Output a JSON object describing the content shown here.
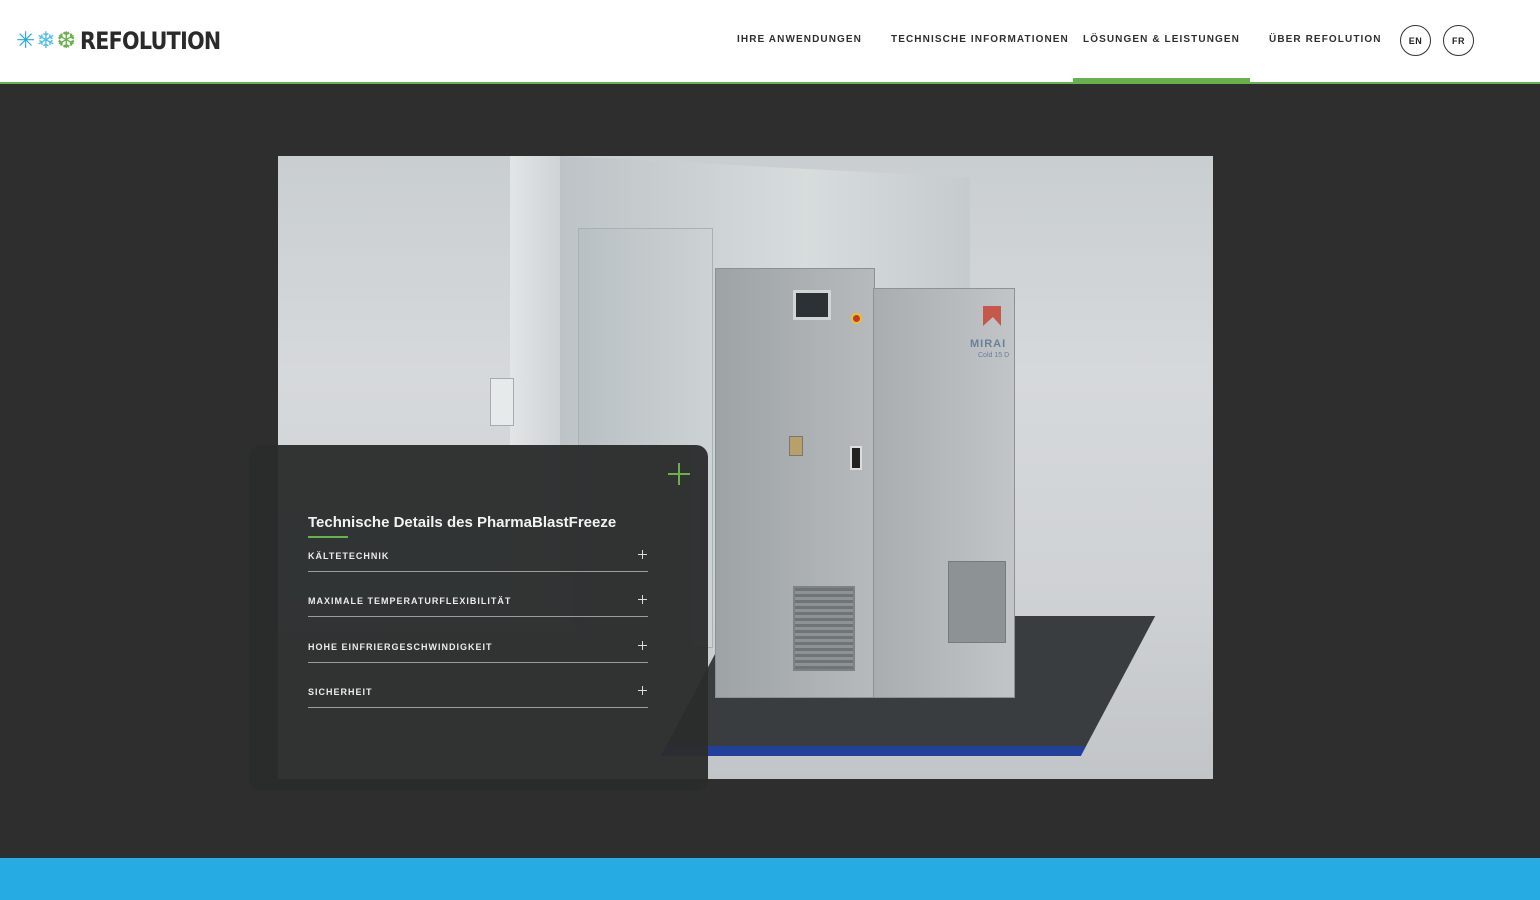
{
  "brand": {
    "name": "REFOLUTION",
    "colors": {
      "green": "#6ab04c",
      "blue": "#29a9e0",
      "dark": "#2e2e2e"
    }
  },
  "nav": {
    "items": [
      {
        "label": "IHRE ANWENDUNGEN",
        "active": false
      },
      {
        "label": "TECHNISCHE INFORMATIONEN",
        "active": false
      },
      {
        "label": "LÖSUNGEN & LEISTUNGEN",
        "active": true
      },
      {
        "label": "ÜBER REFOLUTION",
        "active": false
      }
    ],
    "languages": [
      "EN",
      "FR"
    ]
  },
  "hero": {
    "machine_brand": "MIRAI",
    "machine_model": "Cold 15 D"
  },
  "card": {
    "title": "Technische Details des PharmaBlastFreeze",
    "items": [
      {
        "label": "KÄLTETECHNIK"
      },
      {
        "label": "MAXIMALE TEMPERATURFLEXIBILITÄT"
      },
      {
        "label": "HOHE EINFRIERGESCHWINDIGKEIT"
      },
      {
        "label": "SICHERHEIT"
      }
    ]
  }
}
